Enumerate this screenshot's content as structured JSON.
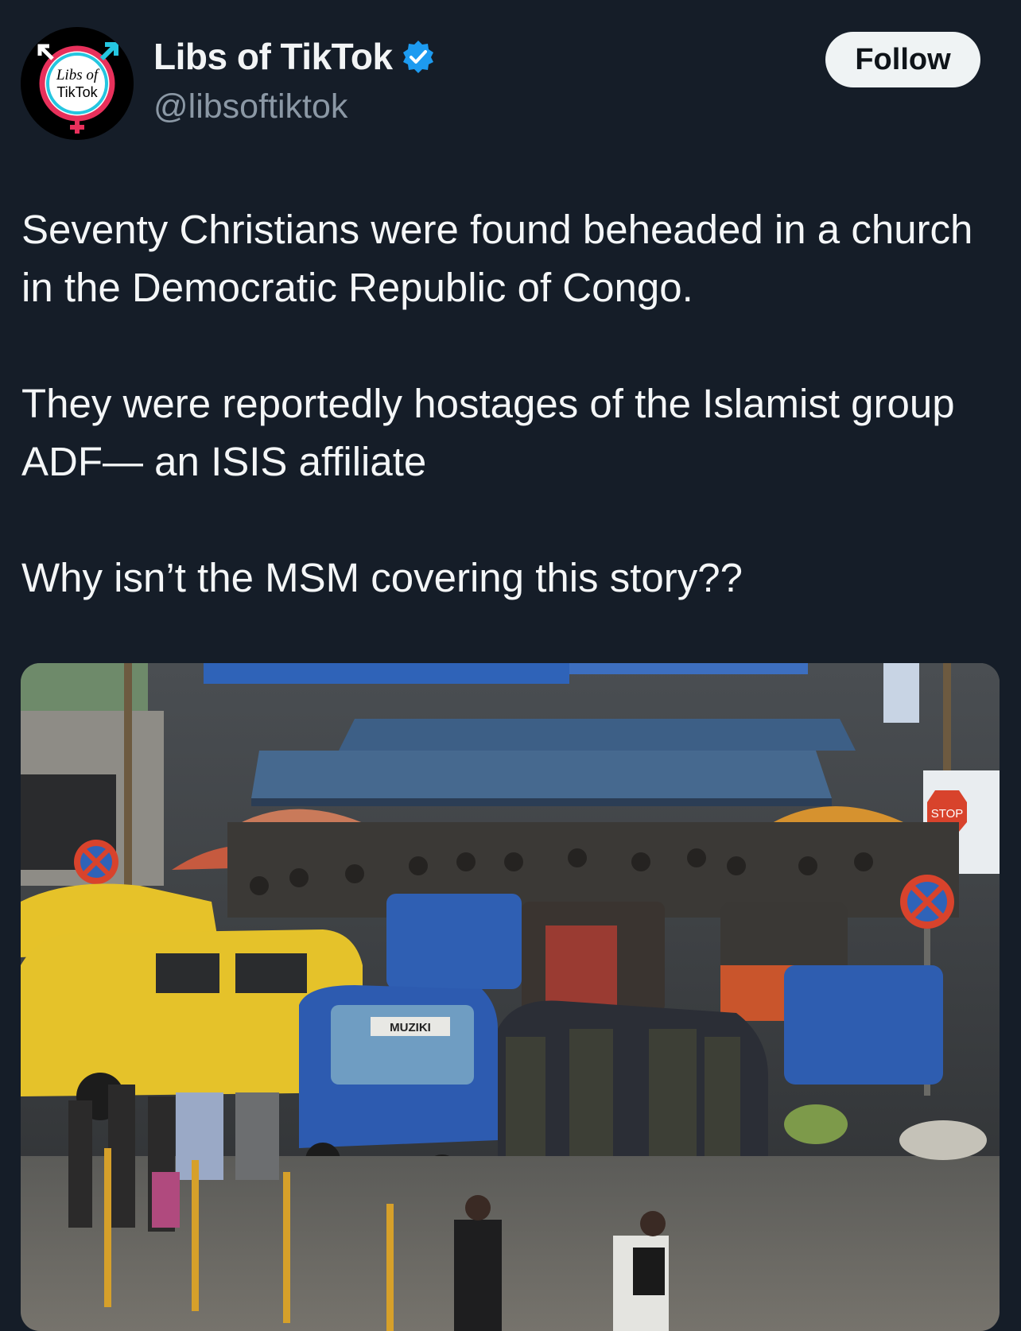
{
  "author": {
    "display_name": "Libs of TikTok",
    "handle": "@libsoftiktok",
    "verified": true,
    "avatar_text": [
      "Libs of",
      "TikTok"
    ]
  },
  "actions": {
    "follow_label": "Follow"
  },
  "tweet": {
    "paragraphs": [
      "Seventy Christians were found beheaded in a church in the Democratic Republic of Congo.",
      "They were reportedly hostages of the Islamist group ADF— an ISIS affiliate",
      "Why isn’t the MSM covering this story??"
    ]
  },
  "media": {
    "sign_text": "STOP",
    "vehicle_plate_text": "MUZIKI"
  },
  "colors": {
    "background": "#151d28",
    "verified_blue": "#1d9bf0",
    "follow_bg": "#eff3f4",
    "handle_gray": "#8b98a5"
  }
}
